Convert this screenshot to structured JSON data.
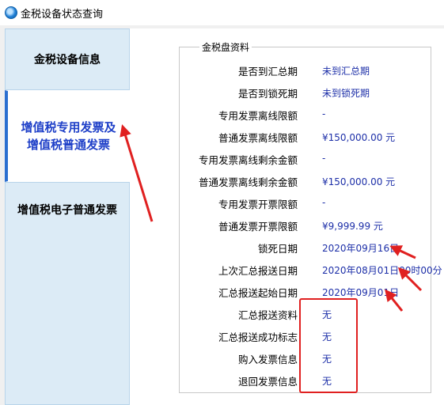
{
  "window": {
    "title": "金税设备状态查询"
  },
  "sidebar": {
    "items": [
      {
        "label": "金税设备信息"
      },
      {
        "label": "增值税专用发票及增值税普通发票",
        "selected": true
      },
      {
        "label": "增值税电子普通发票"
      }
    ]
  },
  "panel": {
    "group_title": "金税盘资料",
    "rows": [
      {
        "label": "是否到汇总期",
        "value": "未到汇总期"
      },
      {
        "label": "是否到锁死期",
        "value": "未到锁死期"
      },
      {
        "label": "专用发票离线限额",
        "value": "-"
      },
      {
        "label": "普通发票离线限额",
        "value": "¥150,000.00 元"
      },
      {
        "label": "专用发票离线剩余金额",
        "value": "-"
      },
      {
        "label": "普通发票离线剩余金额",
        "value": "¥150,000.00 元"
      },
      {
        "label": "专用发票开票限额",
        "value": "-"
      },
      {
        "label": "普通发票开票限额",
        "value": "¥9,999.99 元"
      },
      {
        "label": "锁死日期",
        "value": "2020年09月16日"
      },
      {
        "label": "上次汇总报送日期",
        "value": "2020年08月01日00时00分"
      },
      {
        "label": "汇总报送起始日期",
        "value": "2020年09月01日"
      },
      {
        "label": "汇总报送资料",
        "value": "无"
      },
      {
        "label": "汇总报送成功标志",
        "value": "无"
      },
      {
        "label": "购入发票信息",
        "value": "无"
      },
      {
        "label": "退回发票信息",
        "value": "无"
      }
    ]
  },
  "colors": {
    "accent_red": "#e02020",
    "value_blue": "#1d2fa8",
    "nav_selected": "#1f40c8"
  }
}
